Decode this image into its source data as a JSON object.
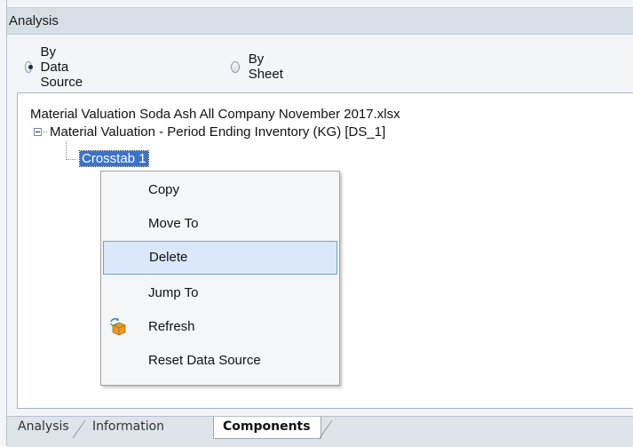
{
  "panel": {
    "title": "Analysis"
  },
  "view_options": {
    "by_data_source": {
      "label": "By Data Source",
      "selected": true
    },
    "by_sheet": {
      "label": "By Sheet",
      "selected": false
    }
  },
  "tree": {
    "root": "Material Valuation Soda Ash All Company November 2017.xlsx",
    "child": "Material Valuation - Period Ending Inventory (KG) [DS_1]",
    "grandchild": "Crosstab 1"
  },
  "context_menu": {
    "items": [
      {
        "label": "Copy",
        "icon": null
      },
      {
        "label": "Move To",
        "icon": null
      },
      {
        "label": "Delete",
        "icon": null,
        "highlighted": true
      },
      {
        "label": "Jump To",
        "icon": null
      },
      {
        "label": "Refresh",
        "icon": "refresh-cube-icon"
      },
      {
        "label": "Reset Data Source",
        "icon": null
      }
    ]
  },
  "bottom_tabs": [
    {
      "label": "Analysis",
      "active": false
    },
    {
      "label": "Information",
      "active": false
    },
    {
      "label": "Components",
      "active": true
    }
  ],
  "colors": {
    "selection": "#3a74c7",
    "menu_hover_bg": "#dbe8fb",
    "menu_hover_border": "#6ea3e0",
    "header_bg": "#d8dee6"
  }
}
